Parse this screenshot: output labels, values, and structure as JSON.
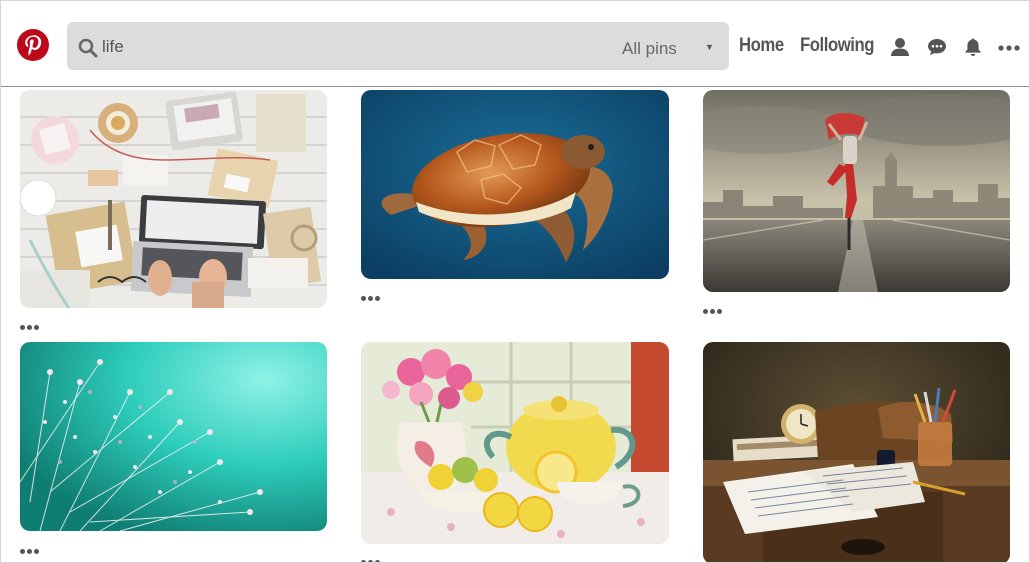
{
  "header": {
    "search": {
      "query": "life",
      "scope": "All pins"
    },
    "nav": {
      "home": "Home",
      "following": "Following"
    },
    "icons": [
      "pinterest-logo-icon",
      "search-icon",
      "chevron-down-icon",
      "user-icon",
      "chat-icon",
      "bell-icon",
      "more-icon"
    ],
    "colors": {
      "brand": "#bd081c",
      "search_bg": "#dcdcdc",
      "nav_text": "#555555"
    }
  },
  "pins": [
    {
      "subject": "workspace with laptop and notebooks"
    },
    {
      "subject": "sea turtle"
    },
    {
      "subject": "dancer on road"
    },
    {
      "subject": "dandelion with dew drops"
    },
    {
      "subject": "tea set with lemons and flowers"
    },
    {
      "subject": "desk with clock and letter"
    }
  ],
  "pin_more_symbol": "•••"
}
